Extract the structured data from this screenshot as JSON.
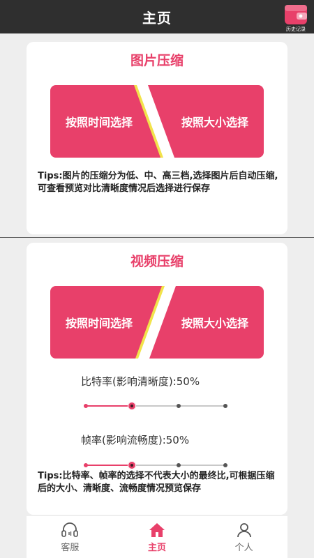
{
  "header": {
    "title": "主页",
    "history_label": "历史记录"
  },
  "image_compress": {
    "title": "图片压缩",
    "by_time_label": "按照时间选择",
    "by_size_label": "按照大小选择",
    "tips": "Tips:图片的压缩分为低、中、高三档,选择图片后自动压缩,可查看预览对比清晰度情况后选择进行保存"
  },
  "video_compress": {
    "title": "视频压缩",
    "by_time_label": "按照时间选择",
    "by_size_label": "按照大小选择",
    "bitrate_label": "比特率(影响清晰度):50%",
    "bitrate_value": 0.5,
    "framerate_label": "帧率(影响流畅度):50%",
    "framerate_value": 0.5,
    "tips": "Tips:比特率、帧率的选择不代表大小的最终比,可根据压缩后的大小、清晰度、流畅度情况预览保存"
  },
  "bottom_nav": {
    "items": [
      {
        "label": "客服",
        "icon": "headset-icon"
      },
      {
        "label": "主页",
        "icon": "home-icon"
      },
      {
        "label": "个人",
        "icon": "person-icon"
      }
    ],
    "active_index": 1
  },
  "colors": {
    "accent": "#e8406a",
    "header_bg": "#2f2f2f",
    "stripe_yellow": "#f2e34b"
  }
}
